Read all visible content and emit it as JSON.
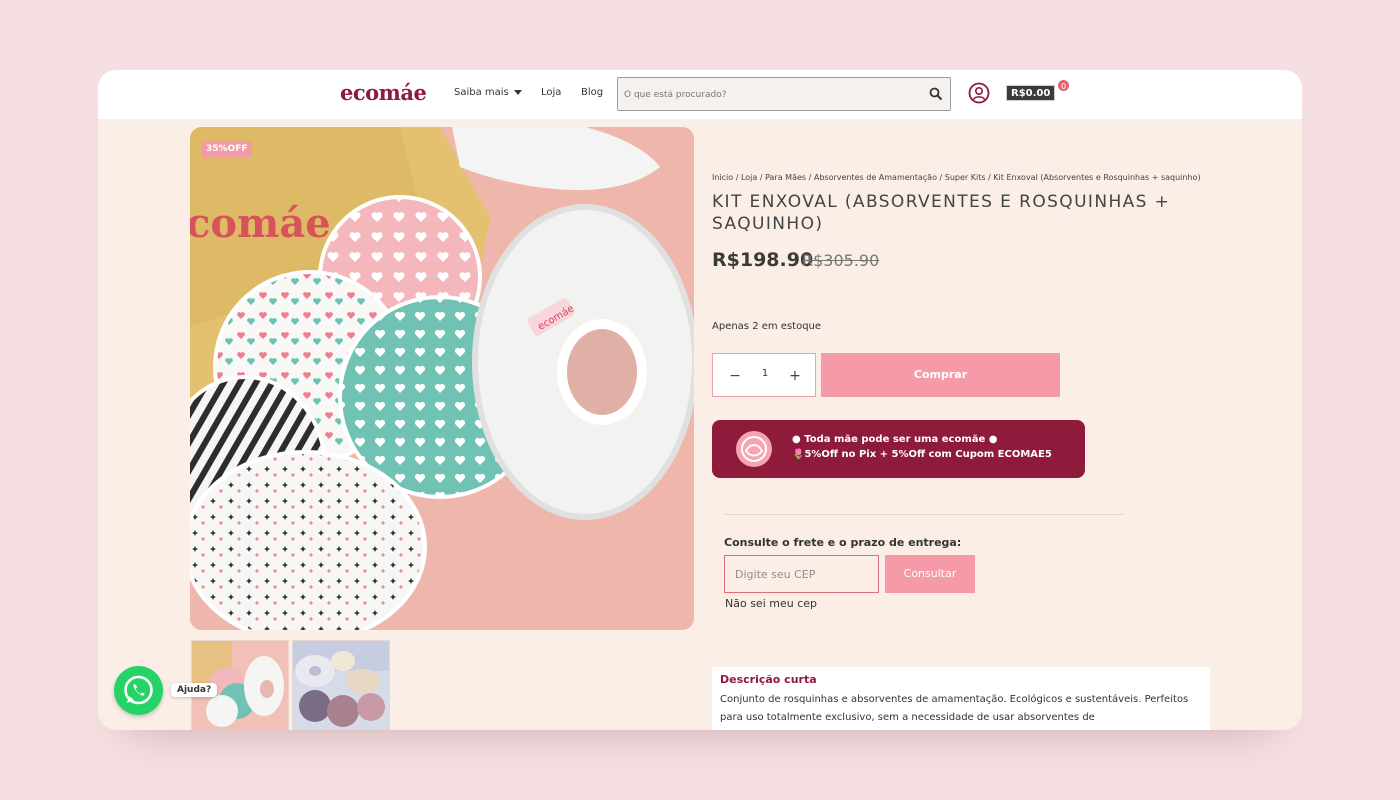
{
  "header": {
    "logo": "ecomáe",
    "nav": [
      "Saiba mais",
      "Loja",
      "Blog"
    ],
    "search_placeholder": "O que está procurado?",
    "cart_total": "R$0.00",
    "cart_count": "0"
  },
  "product": {
    "badge": "35%OFF",
    "breadcrumb": "Inicio / Loja / Para Mães / Absorventes de Amamentação / Super Kits / Kit Enxoval (Absorventes e Rosquinhas + saquinho)",
    "title": "KIT ENXOVAL (ABSORVENTES E ROSQUINHAS + SAQUINHO)",
    "price": "R$198.90",
    "old_price": "R$305.90",
    "stock": "Apenas 2 em estoque",
    "quantity": "1",
    "qty_minus": "−",
    "qty_plus": "+",
    "buy_label": "Comprar"
  },
  "promo": {
    "line1": "● Toda mãe pode ser uma ecomãe ●",
    "line2": "🌷5%Off no Pix + 5%Off com Cupom ECOMAE5"
  },
  "shipping": {
    "title": "Consulte o frete e o prazo de entrega:",
    "cep_placeholder": "Digite seu CEP",
    "consult_label": "Consultar",
    "unknown_cep": "Não sei meu cep"
  },
  "description": {
    "title": "Descrição curta",
    "text": "Conjunto de rosquinhas e absorventes de amamentação. Ecológicos e sustentáveis. Perfeitos para uso totalmente exclusivo, sem a necessidade de usar absorventes de"
  },
  "chat": {
    "help_label": "Ajuda?"
  },
  "colors": {
    "brand": "#8e1b3c",
    "accent_pink": "#f59ba8",
    "whatsapp": "#25d366"
  },
  "icons": [
    "search-icon",
    "user-icon",
    "cart-icon",
    "chevron-down-icon",
    "whatsapp-icon"
  ]
}
